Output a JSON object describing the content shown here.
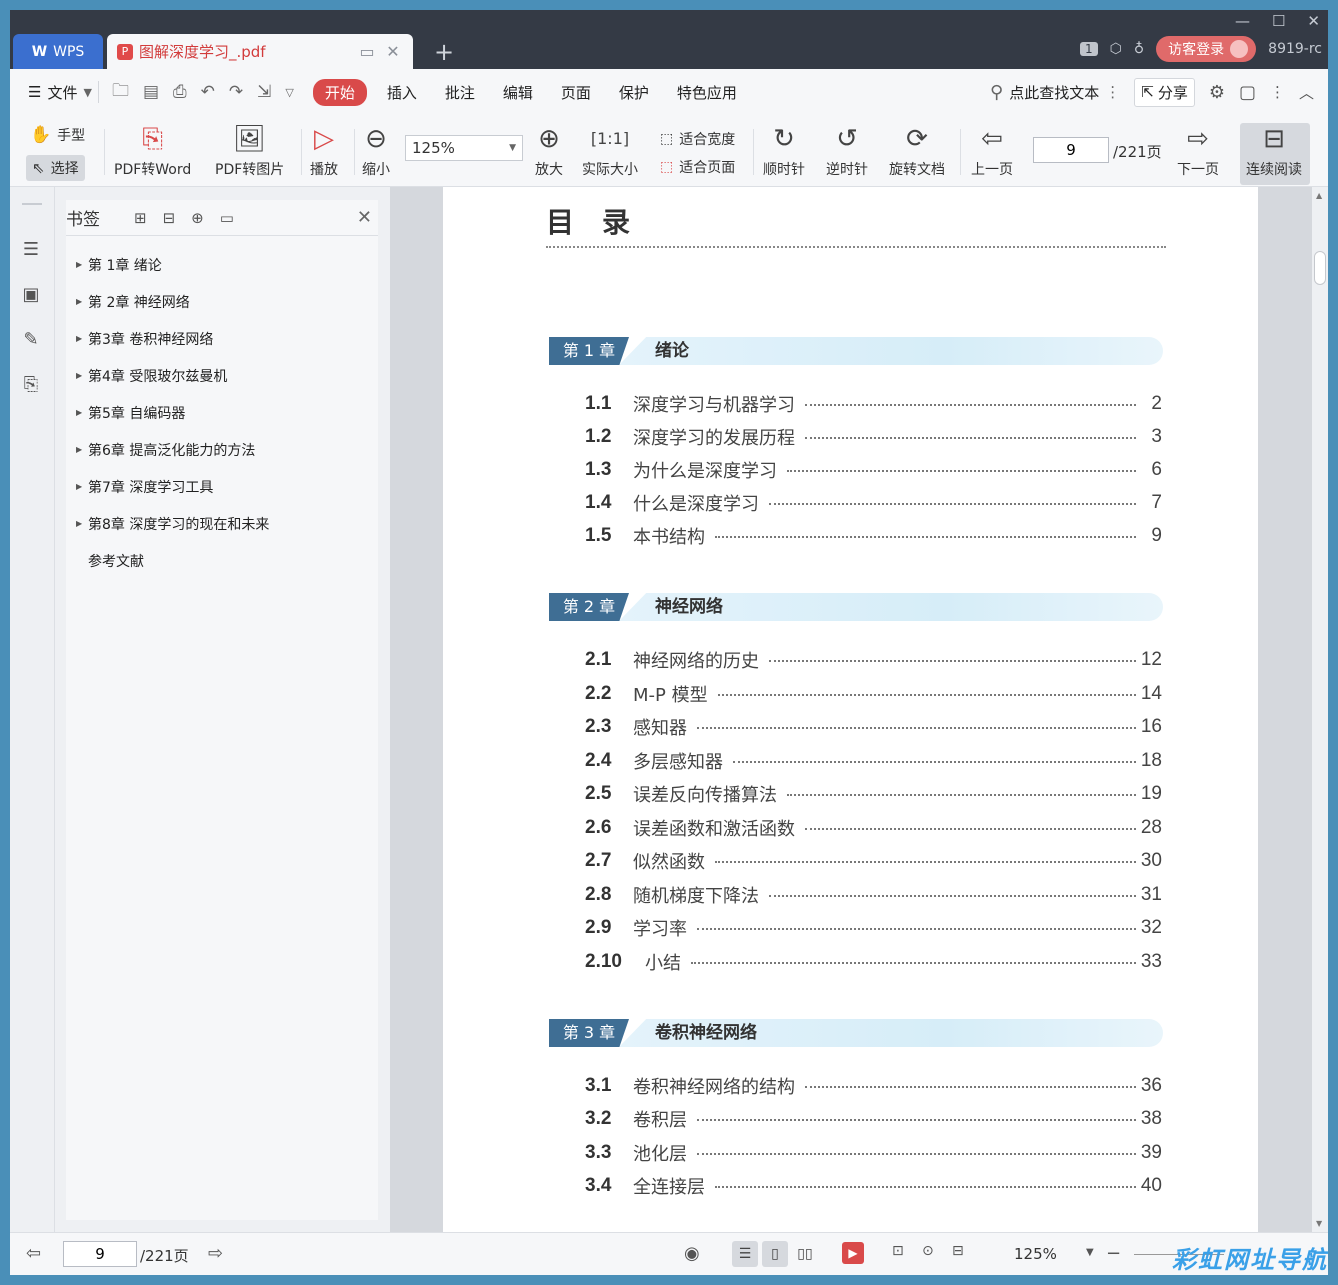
{
  "titlebar": {
    "app_tab": "WPS",
    "doc_tab": "图解深度学习_.pdf",
    "page_badge": "1",
    "login": "访客登录",
    "user_id": "8919-rc"
  },
  "menubar": {
    "file": "文件",
    "start": "开始",
    "items": [
      "插入",
      "批注",
      "编辑",
      "页面",
      "保护",
      "特色应用"
    ],
    "search": "点此查找文本",
    "share": "分享"
  },
  "toolbar": {
    "hand": "手型",
    "select": "选择",
    "pdf_word": "PDF转Word",
    "pdf_img": "PDF转图片",
    "play": "播放",
    "zoom_out": "缩小",
    "zoom_value": "125%",
    "zoom_in": "放大",
    "actual": "实际大小",
    "fit_width": "适合宽度",
    "fit_page": "适合页面",
    "cw": "顺时针",
    "ccw": "逆时针",
    "rotate": "旋转文档",
    "prev": "上一页",
    "page": "9",
    "total": "/221页",
    "next": "下一页",
    "cont": "连续阅读"
  },
  "sidebar": {
    "title": "书签",
    "items": [
      {
        "label": "第 1章 绪论",
        "arrow": true
      },
      {
        "label": "第 2章 神经网络",
        "arrow": true
      },
      {
        "label": "第3章 卷积神经网络",
        "arrow": true
      },
      {
        "label": "第4章 受限玻尔兹曼机",
        "arrow": true
      },
      {
        "label": "第5章 自编码器",
        "arrow": true
      },
      {
        "label": "第6章 提高泛化能力的方法",
        "arrow": true
      },
      {
        "label": "第7章 深度学习工具",
        "arrow": true
      },
      {
        "label": "第8章 深度学习的现在和未来",
        "arrow": true
      },
      {
        "label": "参考文献",
        "arrow": false
      }
    ]
  },
  "doc": {
    "title": "目录",
    "chapters": [
      {
        "badge": "第 1 章",
        "title": "绪论",
        "entries": [
          {
            "num": "1.1",
            "text": "深度学习与机器学习",
            "page": "2"
          },
          {
            "num": "1.2",
            "text": "深度学习的发展历程",
            "page": "3"
          },
          {
            "num": "1.3",
            "text": "为什么是深度学习",
            "page": "6"
          },
          {
            "num": "1.4",
            "text": "什么是深度学习",
            "page": "7"
          },
          {
            "num": "1.5",
            "text": "本书结构",
            "page": "9"
          }
        ]
      },
      {
        "badge": "第 2 章",
        "title": "神经网络",
        "entries": [
          {
            "num": "2.1",
            "text": "神经网络的历史",
            "page": "12"
          },
          {
            "num": "2.2",
            "text": "M-P 模型",
            "page": "14"
          },
          {
            "num": "2.3",
            "text": "感知器",
            "page": "16"
          },
          {
            "num": "2.4",
            "text": "多层感知器",
            "page": "18"
          },
          {
            "num": "2.5",
            "text": "误差反向传播算法",
            "page": "19"
          },
          {
            "num": "2.6",
            "text": "误差函数和激活函数",
            "page": "28"
          },
          {
            "num": "2.7",
            "text": "似然函数",
            "page": "30"
          },
          {
            "num": "2.8",
            "text": "随机梯度下降法",
            "page": "31"
          },
          {
            "num": "2.9",
            "text": "学习率",
            "page": "32"
          },
          {
            "num": "2.10",
            "text": "小结",
            "page": "33"
          }
        ]
      },
      {
        "badge": "第 3 章",
        "title": "卷积神经网络",
        "entries": [
          {
            "num": "3.1",
            "text": "卷积神经网络的结构",
            "page": "36"
          },
          {
            "num": "3.2",
            "text": "卷积层",
            "page": "38"
          },
          {
            "num": "3.3",
            "text": "池化层",
            "page": "39"
          },
          {
            "num": "3.4",
            "text": "全连接层",
            "page": "40"
          }
        ]
      }
    ]
  },
  "status": {
    "page": "9",
    "total": "/221页",
    "zoom": "125%",
    "watermark": "彩虹网址导航"
  }
}
